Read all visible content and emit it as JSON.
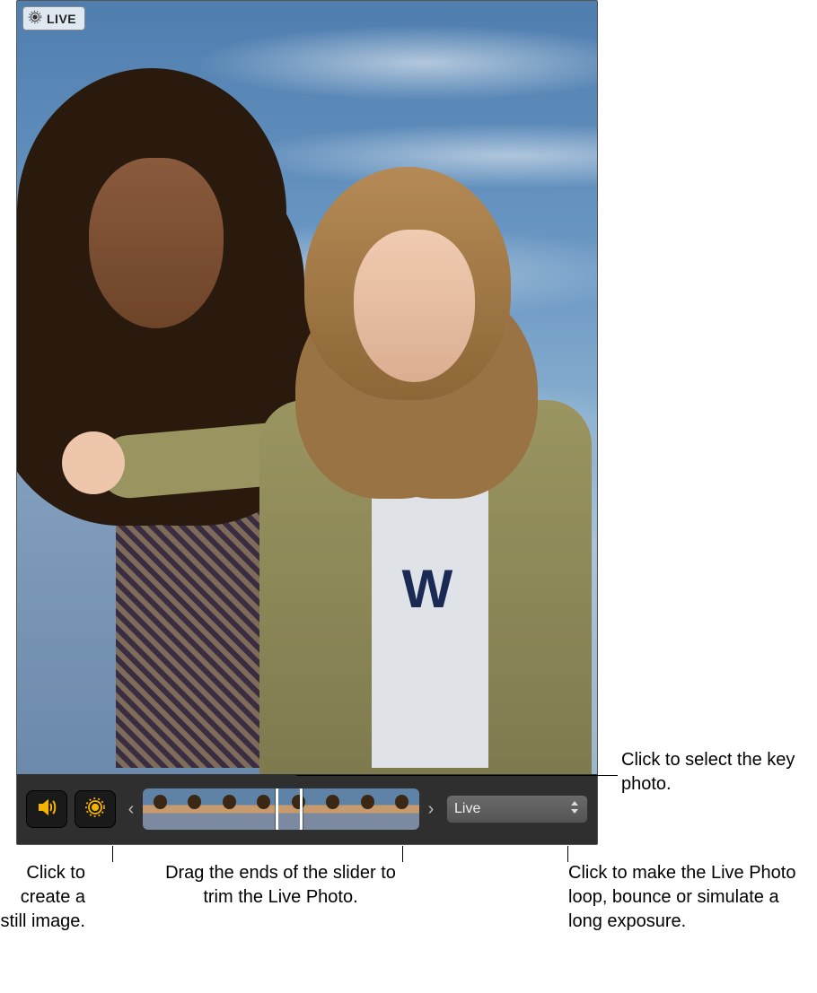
{
  "badge": {
    "label": "LIVE"
  },
  "tee_text": "W",
  "toolbar": {
    "speaker_tip": "speaker",
    "live_off_tip": "live-photo-toggle"
  },
  "effect": {
    "selected": "Live"
  },
  "callouts": {
    "key_photo": "Click to select the key photo.",
    "still": "Click to create a still image.",
    "trim": "Drag the ends of the slider to trim the Live Photo.",
    "effects": "Click to make the Live Photo loop, bounce or simulate a long exposure."
  }
}
